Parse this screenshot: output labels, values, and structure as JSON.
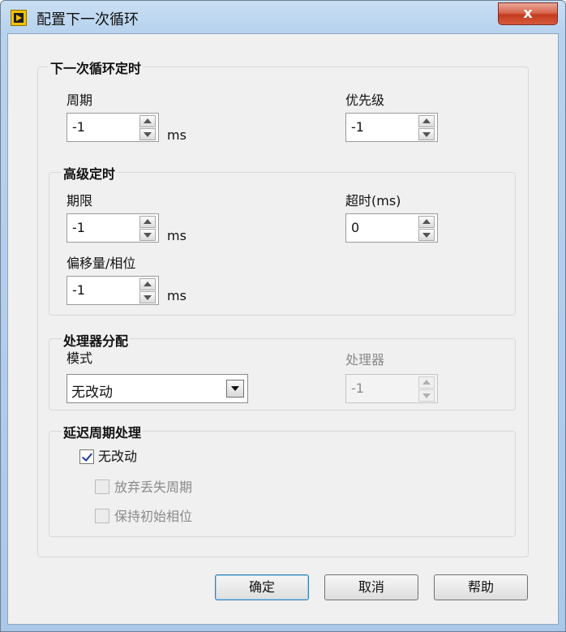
{
  "window": {
    "title": "配置下一次循环",
    "close_label": "x"
  },
  "next_loop_timing": {
    "title": "下一次循环定时",
    "period_label": "周期",
    "period_value": "-1",
    "period_unit": "ms",
    "priority_label": "优先级",
    "priority_value": "-1"
  },
  "advanced_timing": {
    "title": "高级定时",
    "deadline_label": "期限",
    "deadline_value": "-1",
    "deadline_unit": "ms",
    "timeout_label": "超时(ms)",
    "timeout_value": "0",
    "offset_label": "偏移量/相位",
    "offset_value": "-1",
    "offset_unit": "ms"
  },
  "processor_assignment": {
    "title": "处理器分配",
    "mode_label": "模式",
    "mode_value": "无改动",
    "processor_label": "处理器",
    "processor_value": "-1"
  },
  "late_period_handling": {
    "title": "延迟周期处理",
    "no_change_label": "无改动",
    "no_change_checked": true,
    "discard_label": "放弃丢失周期",
    "discard_checked": false,
    "keep_phase_label": "保持初始相位",
    "keep_phase_checked": false
  },
  "buttons": {
    "ok": "确定",
    "cancel": "取消",
    "help": "帮助"
  }
}
